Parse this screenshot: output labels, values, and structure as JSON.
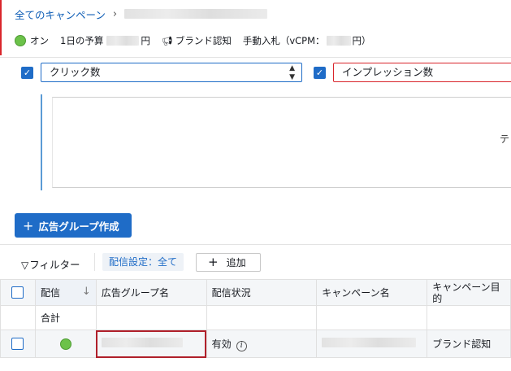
{
  "breadcrumb": {
    "root": "全てのキャンペーン",
    "separator": "›"
  },
  "status": {
    "on_label": "オン",
    "budget_label": "1日の予算",
    "budget_unit": "円",
    "objective": "ブランド認知",
    "bidding_label": "手動入札（vCPM：",
    "bidding_unit": "円）",
    "colors": {
      "on": "#6cc24a"
    }
  },
  "metrics": {
    "metric1": "クリック数",
    "metric2": "インプレッション数",
    "chart_edge_text": "テ"
  },
  "create_button": {
    "icon": "plus-icon",
    "label": "広告グループ作成"
  },
  "filter": {
    "label": "フィルター",
    "chip": "配信設定：全て",
    "add_label": "追加"
  },
  "table": {
    "columns": [
      "配信",
      "広告グループ名",
      "配信状況",
      "キャンペーン名",
      "キャンペーン目的"
    ],
    "total_label": "合計",
    "rows": [
      {
        "status": "有効",
        "objective": "ブランド認知"
      }
    ]
  },
  "accent_color": "#1f6cc7"
}
